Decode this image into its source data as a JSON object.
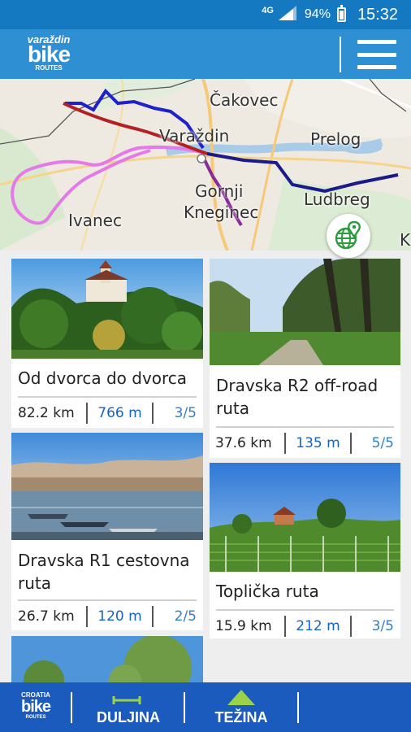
{
  "status_bar": {
    "network": "4G",
    "battery": "94%",
    "time": "15:32"
  },
  "app_bar": {
    "logo_line1": "varaždin",
    "logo_line2": "bike",
    "logo_line3": "ROUTES",
    "menu_icon": "hamburger-menu-icon"
  },
  "map": {
    "cities": [
      "Čakovec",
      "Prelog",
      "Varaždin",
      "Gornji",
      "Kneginec",
      "Ivanec",
      "Ludbreg",
      "K"
    ],
    "route_colors": {
      "blue": "#1e22c8",
      "navy": "#1b1a8a",
      "red": "#b22222",
      "pink": "#e37ae8",
      "purple": "#8c2a9c"
    },
    "fab_icon": "map-globe-pin-icon"
  },
  "routes": [
    {
      "name": "Od dvorca do dvorca",
      "distance": "82.2 km",
      "elevation": "766 m",
      "difficulty": "3/5",
      "photo": "castle-on-hill"
    },
    {
      "name": "Dravska R2 off-road ruta",
      "distance": "37.6 km",
      "elevation": "135 m",
      "difficulty": "5/5",
      "photo": "dirt-path"
    },
    {
      "name": "Dravska R1 cestovna ruta",
      "distance": "26.7 km",
      "elevation": "120 m",
      "difficulty": "2/5",
      "photo": "lake-boats"
    },
    {
      "name": "Toplička ruta",
      "distance": "15.9 km",
      "elevation": "212 m",
      "difficulty": "3/5",
      "photo": "vineyard"
    },
    {
      "name": "",
      "distance": "",
      "elevation": "",
      "difficulty": "",
      "photo": "trees-sky"
    }
  ],
  "bottom_nav": {
    "logo_line1": "CROATIA",
    "logo_line2": "bike",
    "logo_line3": "ROUTES",
    "length_label": "DULJINA",
    "difficulty_label": "TEŽINA"
  },
  "colors": {
    "status_bar": "#1479c0",
    "app_bar": "#2f8fd3",
    "bottom_nav": "#1b5bbe",
    "elevation_text": "#1463c8",
    "difficulty_text": "#2f80c8"
  }
}
